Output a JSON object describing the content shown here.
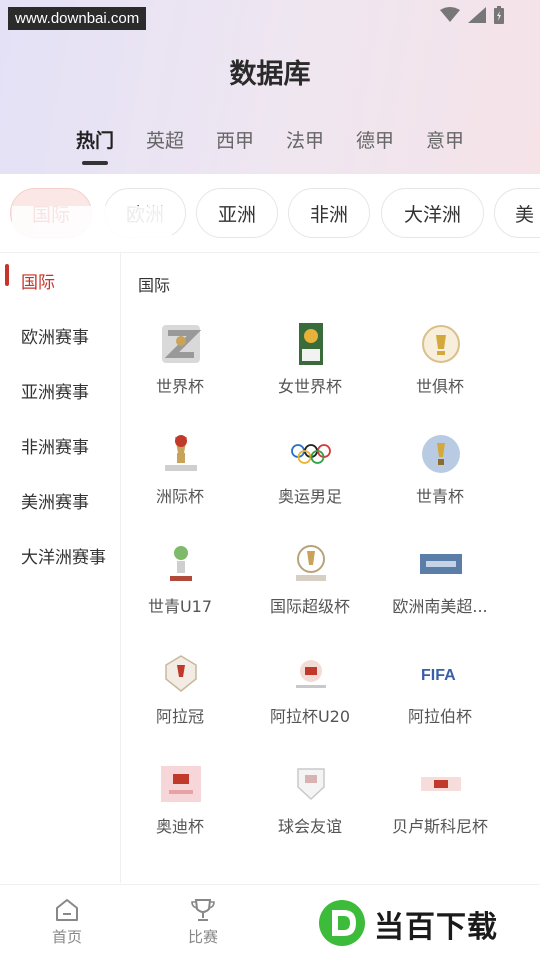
{
  "watermark": "www.downbai.com",
  "title": "数据库",
  "league_tabs": [
    {
      "label": "热门",
      "active": true
    },
    {
      "label": "英超",
      "active": false
    },
    {
      "label": "西甲",
      "active": false
    },
    {
      "label": "法甲",
      "active": false
    },
    {
      "label": "德甲",
      "active": false
    },
    {
      "label": "意甲",
      "active": false
    }
  ],
  "region_pills": [
    {
      "label": "国际",
      "active": true
    },
    {
      "label": "欧洲",
      "active": false
    },
    {
      "label": "亚洲",
      "active": false
    },
    {
      "label": "非洲",
      "active": false
    },
    {
      "label": "大洋洲",
      "active": false
    },
    {
      "label": "美",
      "active": false
    }
  ],
  "sidebar": {
    "items": [
      {
        "label": "国际",
        "active": true
      },
      {
        "label": "欧洲赛事",
        "active": false
      },
      {
        "label": "亚洲赛事",
        "active": false
      },
      {
        "label": "非洲赛事",
        "active": false
      },
      {
        "label": "美洲赛事",
        "active": false
      },
      {
        "label": "大洋洲赛事",
        "active": false
      }
    ]
  },
  "content": {
    "section_title": "国际",
    "competitions": [
      {
        "name": "世界杯",
        "icon": "world-cup-logo"
      },
      {
        "name": "女世界杯",
        "icon": "womens-world-cup-logo"
      },
      {
        "name": "世俱杯",
        "icon": "club-world-cup-logo"
      },
      {
        "name": "洲际杯",
        "icon": "confederations-cup-logo"
      },
      {
        "name": "奥运男足",
        "icon": "olympic-rings-logo"
      },
      {
        "name": "世青杯",
        "icon": "u20-world-cup-logo"
      },
      {
        "name": "世青U17",
        "icon": "u17-world-cup-logo"
      },
      {
        "name": "国际超级杯",
        "icon": "intercontinental-cup-logo"
      },
      {
        "name": "欧洲南美超...",
        "icon": "finalissima-logo"
      },
      {
        "name": "阿拉冠",
        "icon": "arab-champions-logo"
      },
      {
        "name": "阿拉杯U20",
        "icon": "arab-cup-u20-logo"
      },
      {
        "name": "阿拉伯杯",
        "icon": "fifa-arab-cup-logo"
      },
      {
        "name": "奥迪杯",
        "icon": "audi-cup-logo"
      },
      {
        "name": "球会友谊",
        "icon": "club-friendly-logo"
      },
      {
        "name": "贝卢斯科尼杯",
        "icon": "berlusconi-trophy-logo"
      }
    ]
  },
  "tabbar": {
    "items": [
      {
        "label": "首页",
        "icon": "home-icon"
      },
      {
        "label": "比赛",
        "icon": "trophy-icon"
      }
    ]
  },
  "brand": {
    "text": "当百下载",
    "icon": "brand-d-icon"
  },
  "colors": {
    "accent": "#c7342a",
    "brand_green": "#3dbb3a"
  }
}
